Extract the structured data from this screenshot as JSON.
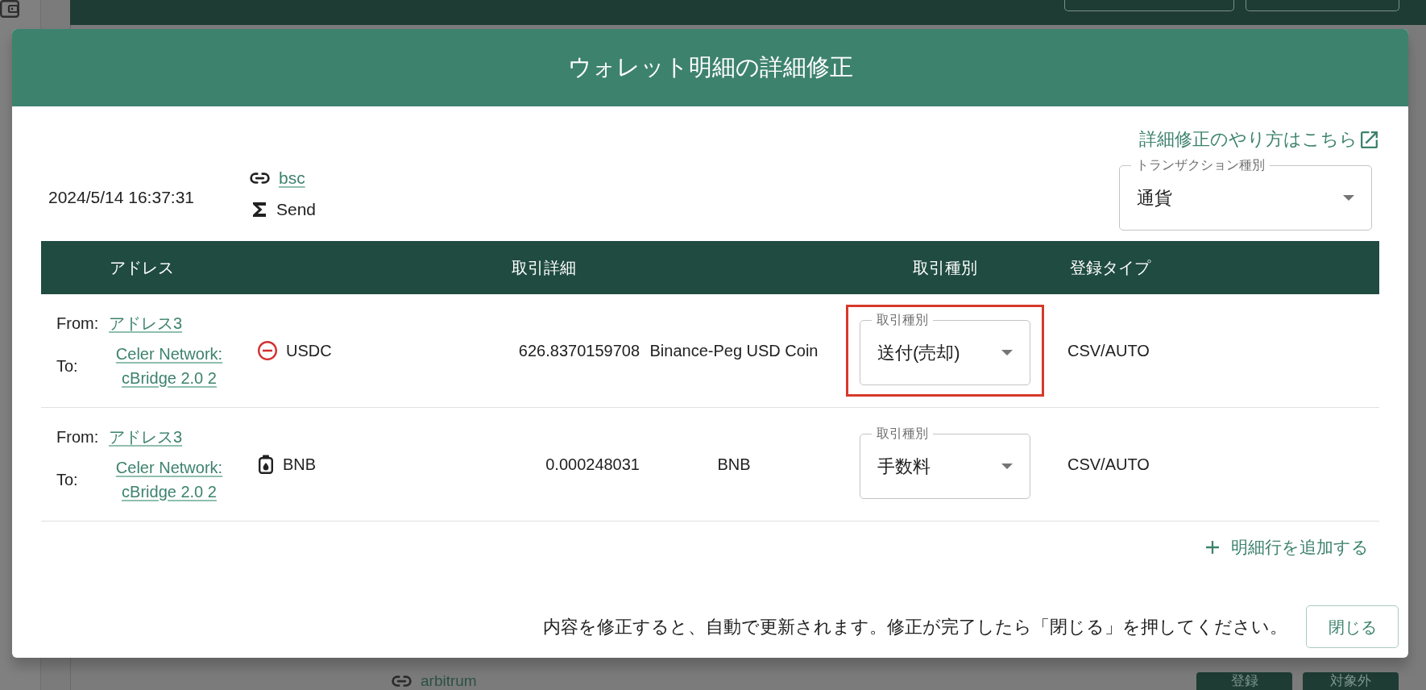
{
  "background": {
    "network_link": "arbitrum",
    "buttons": [
      "登録",
      "対象外"
    ]
  },
  "dialog": {
    "title": "ウォレット明細の詳細修正",
    "help_link": "詳細修正のやり方はこちら",
    "timestamp": "2024/5/14 16:37:31",
    "chain": "bsc",
    "transaction_kind": "Send",
    "transaction_type": {
      "label": "トランザクション種別",
      "value": "通貨"
    },
    "table": {
      "columns": [
        "アドレス",
        "取引詳細",
        "取引種別",
        "登録タイプ"
      ],
      "rows": [
        {
          "kind": "send",
          "from_label": "From:",
          "from": "アドレス3",
          "to_label": "To:",
          "to": "Celer Network: cBridge 2.0 2",
          "asset": "USDC",
          "amount": "626.8370159708",
          "asset_name": "Binance-Peg USD Coin",
          "type_select": {
            "label": "取引種別",
            "value": "送付(売却)"
          },
          "registration": "CSV/AUTO",
          "highlighted": true
        },
        {
          "kind": "fee",
          "from_label": "From:",
          "from": "アドレス3",
          "to_label": "To:",
          "to": "Celer Network: cBridge 2.0 2",
          "asset": "BNB",
          "amount": "0.000248031",
          "asset_name": "BNB",
          "type_select": {
            "label": "取引種別",
            "value": "手数料"
          },
          "registration": "CSV/AUTO",
          "highlighted": false
        }
      ]
    },
    "add_row_button": "明細行を追加する",
    "footer_note": "内容を修正すると、自動で更新されます。修正が完了したら「閉じる」を押してください。",
    "close_button": "閉じる"
  }
}
